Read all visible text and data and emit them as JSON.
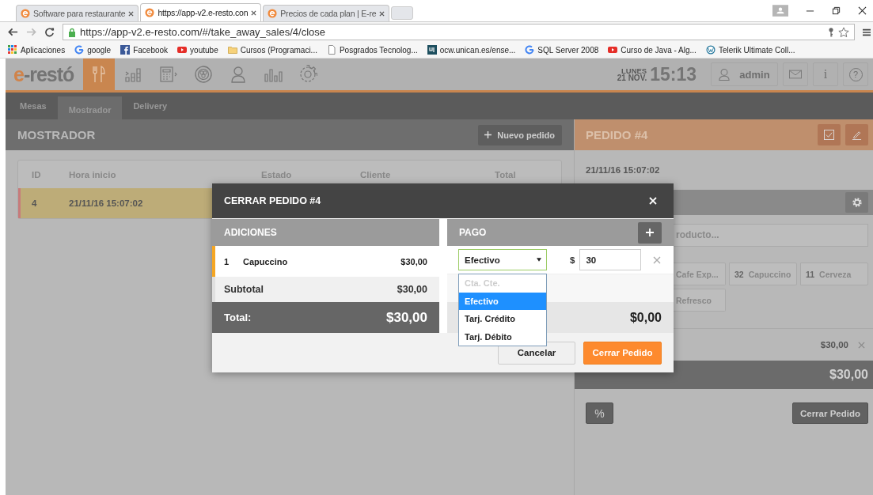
{
  "browser": {
    "tabs": [
      {
        "title": "Software para restaurante",
        "selected": false
      },
      {
        "title": "https://app-v2.e-resto.con",
        "selected": true
      },
      {
        "title": "Precios de cada plan | E-re",
        "selected": false
      }
    ],
    "url": "https://app-v2.e-resto.com/#/take_away_sales/4/close",
    "bookmarks": [
      {
        "label": "Aplicaciones",
        "kind": "apps"
      },
      {
        "label": "google",
        "kind": "google"
      },
      {
        "label": "Facebook",
        "kind": "facebook"
      },
      {
        "label": "youtube",
        "kind": "youtube"
      },
      {
        "label": "Cursos (Programaci...",
        "kind": "folder"
      },
      {
        "label": "Posgrados Tecnolog...",
        "kind": "page"
      },
      {
        "label": "ocw.unican.es/ense...",
        "kind": "uc"
      },
      {
        "label": "SQL Server 2008",
        "kind": "google"
      },
      {
        "label": "Curso de Java - Alg...",
        "kind": "youtube"
      },
      {
        "label": "Telerik Ultimate Coll...",
        "kind": "wordpress"
      }
    ]
  },
  "header": {
    "logo_mark": "e",
    "logo_text": "-restó",
    "nav": [
      {
        "kind": "cutlery",
        "selected": true
      },
      {
        "kind": "steps",
        "selected": false
      },
      {
        "kind": "calculator",
        "selected": false
      },
      {
        "kind": "dish",
        "selected": false
      },
      {
        "kind": "person",
        "selected": false
      },
      {
        "kind": "chart",
        "selected": false
      },
      {
        "kind": "gear",
        "selected": false
      }
    ],
    "day": "LUNES",
    "date": "21 NOV.",
    "time": "15:13",
    "user": "admin",
    "info_button": "i",
    "help_button": "?"
  },
  "subnav": [
    {
      "label": "Mesas",
      "selected": false
    },
    {
      "label": "Mostrador",
      "selected": true
    },
    {
      "label": "Delivery",
      "selected": false
    }
  ],
  "mostrador": {
    "title": "MOSTRADOR",
    "new_order_button": "Nuevo pedido",
    "columns": [
      "ID",
      "Hora inicio",
      "Estado",
      "Cliente",
      "Total"
    ],
    "rows": [
      {
        "cells": [
          "4",
          "21/11/16 15:07:02"
        ],
        "selected": true
      }
    ]
  },
  "pedido": {
    "title": "PEDIDO #4",
    "datetime": "21/11/16 15:07:02",
    "search_placeholder": "roducto...",
    "products": [
      {
        "name": "Cafe Exp..."
      },
      {
        "code": "32",
        "name": "Capuccino"
      },
      {
        "code": "11",
        "name": "Cerveza"
      },
      {
        "name": "Refresco"
      }
    ],
    "line_amount": "$30,00",
    "total": "$30,00",
    "discount_button": "%",
    "close_button": "Cerrar Pedido"
  },
  "modal": {
    "title": "CERRAR PEDIDO #4",
    "additions_header": "ADICIONES",
    "items": [
      {
        "qty": "1",
        "name": "Capuccino",
        "price": "$30,00"
      }
    ],
    "subtotal_label": "Subtotal",
    "subtotal": "$30,00",
    "total_label": "Total:",
    "total": "$30,00",
    "payment_header": "PAGO",
    "payment": {
      "method": "Efectivo",
      "currency": "$",
      "amount": "30"
    },
    "options": [
      {
        "label": "Cta. Cte.",
        "disabled": true,
        "selected": false
      },
      {
        "label": "Efectivo",
        "disabled": false,
        "selected": true
      },
      {
        "label": "Tarj. Crédito",
        "disabled": false,
        "selected": false
      },
      {
        "label": "Tarj. Débito",
        "disabled": false,
        "selected": false
      }
    ],
    "remaining": "$0,00",
    "cancel_button": "Cancelar",
    "confirm_button": "Cerrar Pedido"
  }
}
